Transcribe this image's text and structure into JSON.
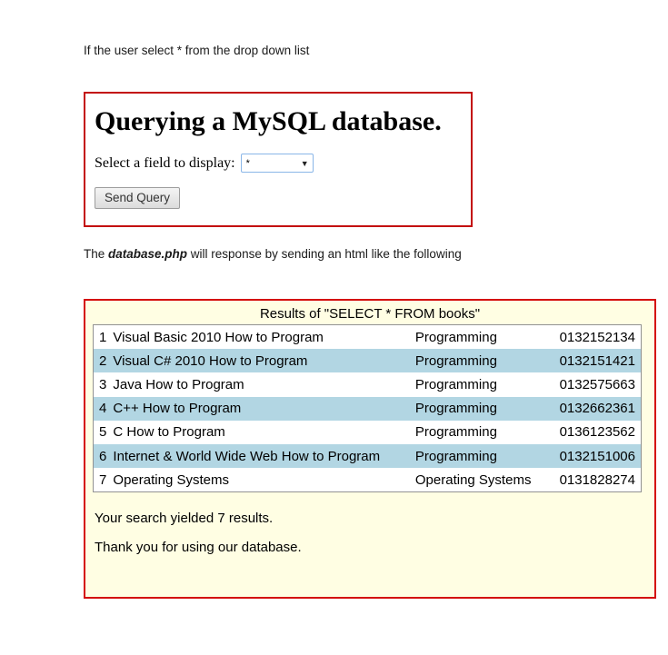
{
  "intro_text": "If the user select * from the drop down list",
  "query_box": {
    "title": "Querying a MySQL database.",
    "field_label": "Select a field to display:",
    "select_value": "*",
    "dropdown_arrow": "▼",
    "button_label": "Send Query"
  },
  "response_text": {
    "prefix": "The ",
    "filename": "database.php",
    "suffix": " will response by sending an html like the following"
  },
  "results_box": {
    "caption": "Results of \"SELECT * FROM books\"",
    "rows": [
      {
        "num": "1",
        "title": "Visual Basic 2010 How to Program",
        "category": "Programming",
        "isbn": "0132152134"
      },
      {
        "num": "2",
        "title": "Visual C# 2010 How to Program",
        "category": "Programming",
        "isbn": "0132151421"
      },
      {
        "num": "3",
        "title": "Java How to Program",
        "category": "Programming",
        "isbn": "0132575663"
      },
      {
        "num": "4",
        "title": "C++ How to Program",
        "category": "Programming",
        "isbn": "0132662361"
      },
      {
        "num": "5",
        "title": "C How to Program",
        "category": "Programming",
        "isbn": "0136123562"
      },
      {
        "num": "6",
        "title": "Internet & World Wide Web How to Program",
        "category": "Programming",
        "isbn": "0132151006"
      },
      {
        "num": "7",
        "title": "Operating Systems",
        "category": "Operating Systems",
        "isbn": "0131828274"
      }
    ],
    "summary": "Your search yielded 7 results.",
    "thanks": "Thank you for using our database."
  },
  "colors": {
    "box_border_red": "#c30b0b",
    "results_background": "#fffee3",
    "row_alternate_blue": "#b2d6e3"
  }
}
